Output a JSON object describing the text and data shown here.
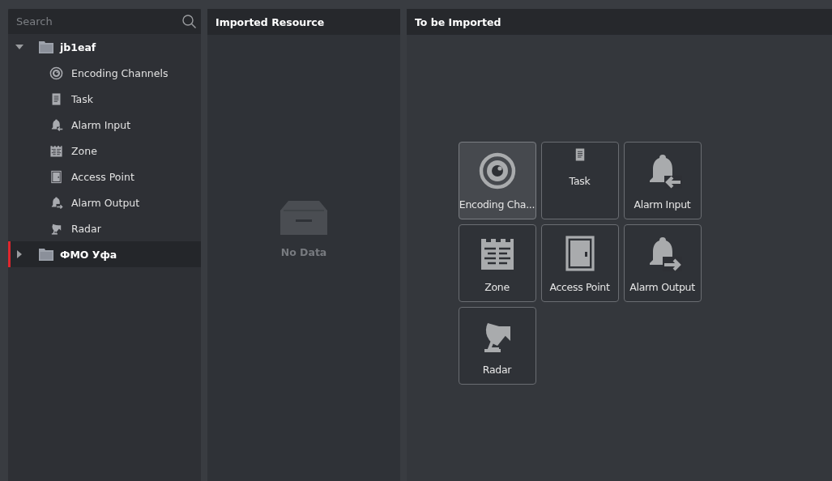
{
  "sidebar": {
    "search": {
      "placeholder": "Search"
    },
    "tree": [
      {
        "label": "jb1eaf",
        "expanded": true,
        "selected": false,
        "children": [
          {
            "label": "Encoding Channels",
            "kind": "channel"
          },
          {
            "label": "Task",
            "kind": "task"
          },
          {
            "label": "Alarm Input",
            "kind": "alarm-input"
          },
          {
            "label": "Zone",
            "kind": "zone"
          },
          {
            "label": "Access Point",
            "kind": "door"
          },
          {
            "label": "Alarm Output",
            "kind": "alarm-output"
          },
          {
            "label": "Radar",
            "kind": "radar"
          }
        ]
      },
      {
        "label": "ФМО Уфа",
        "expanded": false,
        "selected": true
      }
    ]
  },
  "imported_panel": {
    "title": "Imported Resource",
    "empty_text": "No Data"
  },
  "to_import_panel": {
    "title": "To be Imported",
    "tiles": [
      {
        "label": "Encoding Cha...",
        "kind": "channel",
        "selected": true
      },
      {
        "label": "Task",
        "kind": "task",
        "selected": false
      },
      {
        "label": "Alarm Input",
        "kind": "alarm-input",
        "selected": false
      },
      {
        "label": "Zone",
        "kind": "zone",
        "selected": false
      },
      {
        "label": "Access Point",
        "kind": "door",
        "selected": false
      },
      {
        "label": "Alarm Output",
        "kind": "alarm-output",
        "selected": false
      },
      {
        "label": "Radar",
        "kind": "radar",
        "selected": false
      }
    ]
  }
}
